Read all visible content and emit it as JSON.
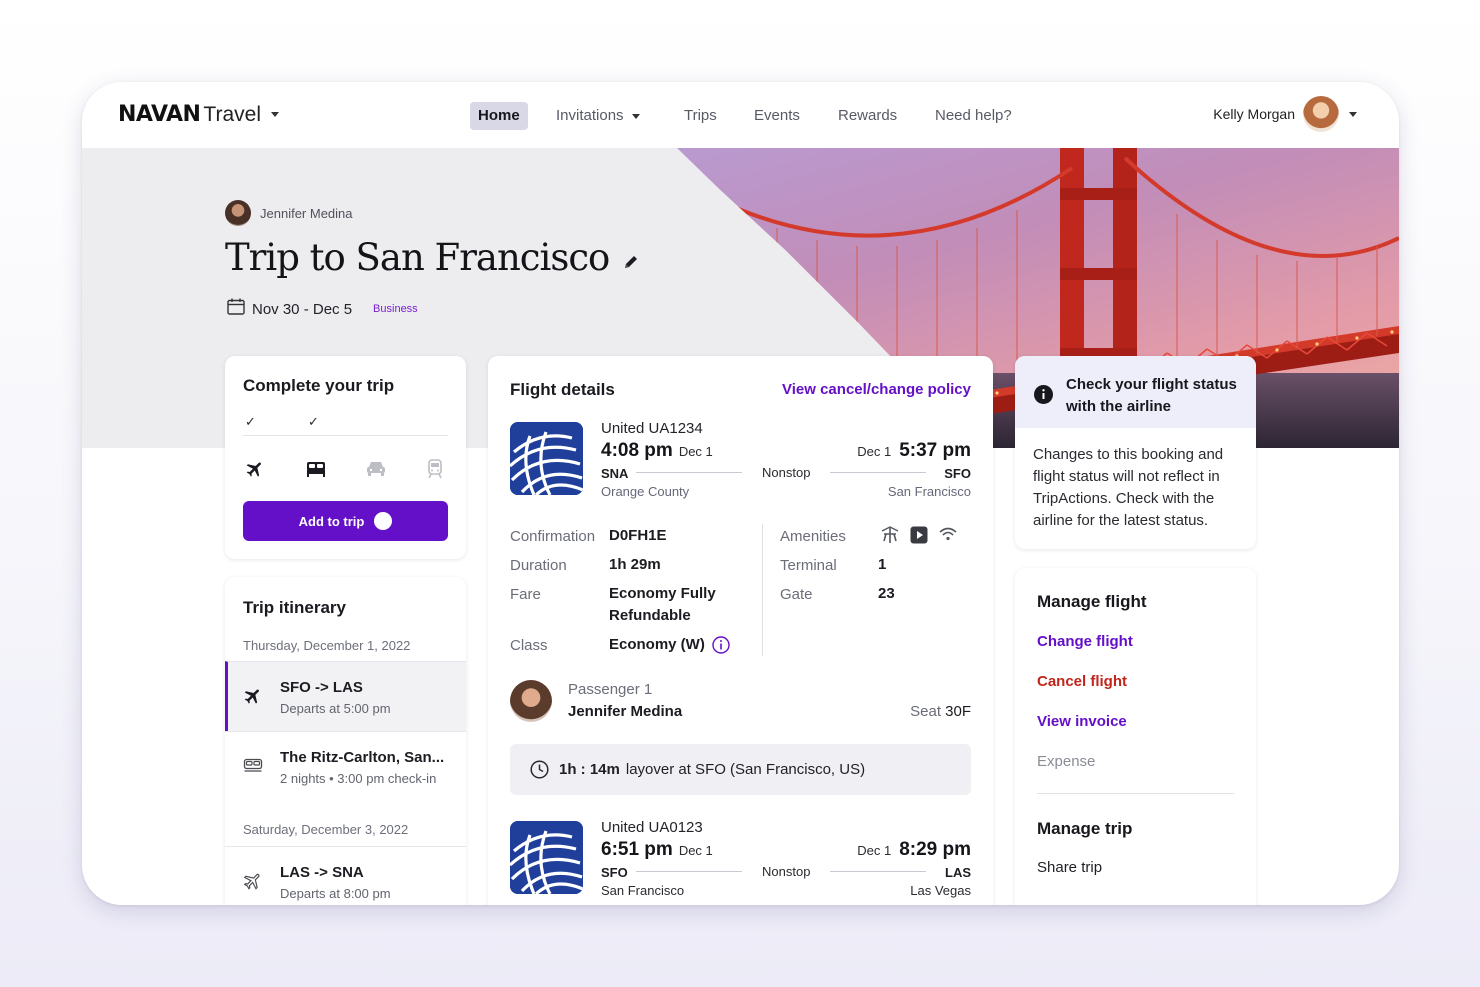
{
  "nav": {
    "brand_logo": "NAVAN",
    "brand_product": "Travel",
    "items": [
      {
        "label": "Home",
        "active": true
      },
      {
        "label": "Invitations",
        "has_dropdown": true
      },
      {
        "label": "Trips"
      },
      {
        "label": "Events"
      },
      {
        "label": "Rewards"
      },
      {
        "label": "Need help?"
      }
    ],
    "user_name": "Kelly Morgan"
  },
  "trip": {
    "owner": "Jennifer Medina",
    "title": "Trip to San Francisco",
    "dates": "Nov 30 - Dec 5",
    "badge": "Business"
  },
  "complete_trip": {
    "title": "Complete your trip",
    "checks": [
      "✓",
      "✓"
    ],
    "modes": [
      "plane-icon",
      "bed-icon",
      "car-icon",
      "train-icon"
    ],
    "add_label": "Add to trip"
  },
  "itinerary": {
    "title": "Trip itinerary",
    "dates": [
      "Thursday, December 1, 2022",
      "Saturday, December 3, 2022"
    ],
    "items": [
      {
        "title": "SFO -> LAS",
        "subtitle": "Departs at 5:00 pm",
        "icon": "plane-icon"
      },
      {
        "title": "The Ritz-Carlton, San...",
        "subtitle": "2 nights • 3:00 pm check-in",
        "icon": "bed-icon"
      },
      {
        "title": "LAS -> SNA",
        "subtitle": "Departs at 8:00 pm",
        "icon": "plane-outline-icon"
      }
    ]
  },
  "flight": {
    "title": "Flight details",
    "policy_link": "View cancel/change policy",
    "segments": [
      {
        "airline": "United  UA1234",
        "dep_time": "4:08 pm",
        "dep_date": "Dec 1",
        "arr_time": "5:37 pm",
        "arr_date": "Dec 1",
        "dep_code": "SNA",
        "arr_code": "SFO",
        "dep_city": "Orange County",
        "arr_city": "San Francisco",
        "stops": "Nonstop"
      },
      {
        "airline": "United  UA0123",
        "dep_time": "6:51 pm",
        "dep_date": "Dec 1",
        "arr_time": "8:29 pm",
        "arr_date": "Dec 1",
        "dep_code": "SFO",
        "arr_code": "LAS",
        "dep_city": "San Francisco",
        "arr_city": "Las Vegas",
        "stops": "Nonstop"
      }
    ],
    "details": {
      "confirmation_label": "Confirmation",
      "confirmation": "D0FH1E",
      "duration_label": "Duration",
      "duration": "1h 29m",
      "fare_label": "Fare",
      "fare_line1": "Economy Fully",
      "fare_line2": "Refundable",
      "class_label": "Class",
      "class": "Economy (W)",
      "amenities_label": "Amenities",
      "amenities": [
        "power-icon",
        "video-icon",
        "wifi-icon"
      ],
      "terminal_label": "Terminal",
      "terminal": "1",
      "gate_label": "Gate",
      "gate": "23"
    },
    "passenger": {
      "label": "Passenger 1",
      "name": "Jennifer Medina",
      "seat_label": "Seat",
      "seat": "30F"
    },
    "layover": {
      "duration": "1h : 14m",
      "text": "layover at SFO (San Francisco, US)"
    }
  },
  "status": {
    "title": "Check your flight status with the airline",
    "body": "Changes to this booking and flight status will not reflect in TripActions. Check with the airline for the latest status."
  },
  "manage": {
    "flight_title": "Manage flight",
    "change": "Change flight",
    "cancel": "Cancel flight",
    "invoice": "View invoice",
    "expense": "Expense",
    "trip_title": "Manage trip",
    "share": "Share trip"
  },
  "colors": {
    "accent": "#6410c9",
    "danger": "#c0261c",
    "airline_blue": "#1f3f9b"
  }
}
